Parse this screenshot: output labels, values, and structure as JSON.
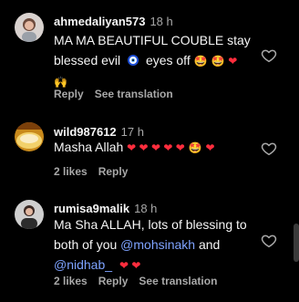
{
  "comments": [
    {
      "username": "ahmedaliyan573",
      "time": "18 h",
      "text_line1": "MA MA BEAUTIFUL COUBLE stay",
      "text_line2": "blessed evil",
      "text_line2b": "eyes off",
      "actions": [
        "Reply",
        "See translation"
      ]
    },
    {
      "username": "wild987612",
      "time": "17 h",
      "text": "Masha Allah",
      "likes": "2 likes",
      "actions": [
        "Reply"
      ]
    },
    {
      "username": "rumisa9malik",
      "time": "18 h",
      "text_line1": "Ma Sha ALLAH, lots of blessing to",
      "text_line2a": "both of you ",
      "mention1": "@mohsinakh",
      "text_line2b": " and",
      "mention2": "@nidhab_",
      "likes": "2 likes",
      "actions": [
        "Reply",
        "See translation"
      ]
    }
  ],
  "colors": {
    "background": "#000000",
    "text": "#f5f5f5",
    "muted": "#a8a8a8",
    "mention": "#7ea3ff",
    "heart": "#ff3040"
  },
  "icons": [
    "avatar",
    "heart-outline-icon",
    "red-heart-emoji",
    "star-struck-emoji",
    "nazar-eye-emoji",
    "raised-hands-emoji"
  ]
}
